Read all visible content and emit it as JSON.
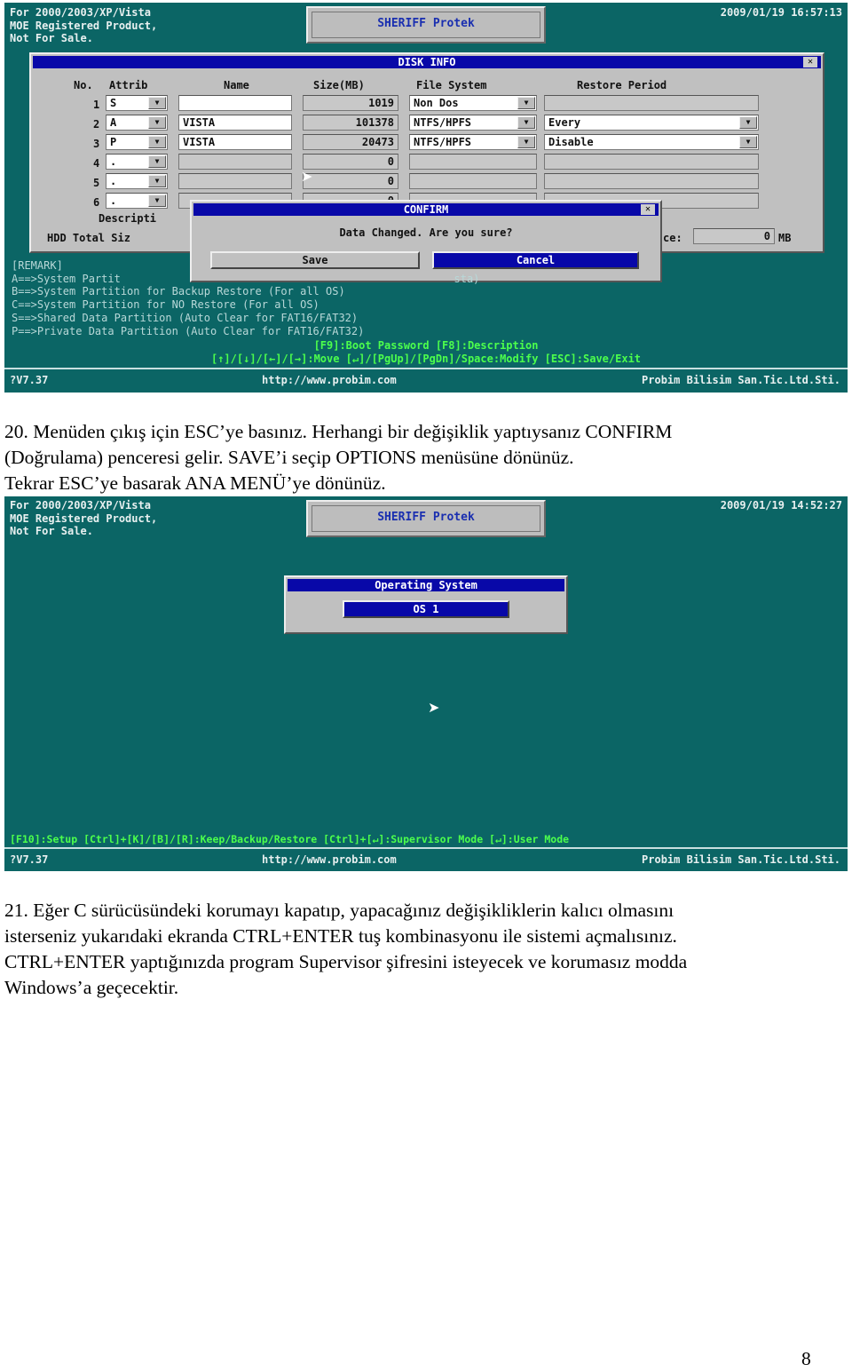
{
  "screen1": {
    "header_lines": [
      "For 2000/2003/XP/Vista",
      "MOE Registered Product,",
      "Not For Sale."
    ],
    "logo": "SHERIFF Protek",
    "datetime": "2009/01/19 16:57:13",
    "disk_info": {
      "title": "DISK INFO",
      "close": "✕",
      "columns": {
        "no": "No.",
        "attrib": "Attrib",
        "name": "Name",
        "size": "Size(MB)",
        "fs": "File System",
        "restore": "Restore Period"
      },
      "rows": [
        {
          "no": "1",
          "attrib": "S",
          "name": "",
          "size": "1019",
          "fs": "Non Dos",
          "restore": ""
        },
        {
          "no": "2",
          "attrib": "A",
          "name": "VISTA",
          "size": "101378",
          "fs": "NTFS/HPFS",
          "restore": "Every"
        },
        {
          "no": "3",
          "attrib": "P",
          "name": "VISTA",
          "size": "20473",
          "fs": "NTFS/HPFS",
          "restore": "Disable"
        },
        {
          "no": "4",
          "attrib": ".",
          "name": "",
          "size": "0",
          "fs": "",
          "restore": ""
        },
        {
          "no": "5",
          "attrib": ".",
          "name": "",
          "size": "0",
          "fs": "",
          "restore": ""
        },
        {
          "no": "6",
          "attrib": ".",
          "name": "",
          "size": "0",
          "fs": "",
          "restore": ""
        }
      ],
      "description_label": "Descripti",
      "hdd_total_label": "HDD Total Siz",
      "free_label": "ce:",
      "free_value": "0",
      "free_unit": "MB"
    },
    "confirm": {
      "title": "CONFIRM",
      "close": "✕",
      "message": "Data Changed. Are you sure?",
      "save": "Save",
      "cancel": "Cancel"
    },
    "remarks": [
      "[REMARK]",
      "A==>System Partit                                                    sta)",
      "B==>System Partition for Backup Restore (For all OS)",
      "C==>System Partition for NO Restore (For all OS)",
      "S==>Shared Data Partition (Auto Clear for FAT16/FAT32)",
      "P==>Private Data Partition (Auto Clear for FAT16/FAT32)"
    ],
    "keys_line1": "[F9]:Boot Password  [F8]:Description",
    "keys_line2": "[↑]/[↓]/[←]/[→]:Move  [↵]/[PgUp]/[PgDn]/Space:Modify  [ESC]:Save/Exit",
    "footer": {
      "version": "?V7.37",
      "url": "http://www.probim.com",
      "company": "Probim Bilisim San.Tic.Ltd.Sti."
    }
  },
  "instruction20": [
    "20. Menüden çıkış için ESC’ye basınız. Herhangi bir değişiklik yaptıysanız CONFIRM",
    "(Doğrulama) penceresi gelir. SAVE’i seçip OPTIONS menüsüne dönünüz.",
    "Tekrar ESC’ye basarak ANA MENÜ’ye dönünüz."
  ],
  "screen2": {
    "header_lines": [
      "For 2000/2003/XP/Vista",
      "MOE Registered Product,",
      "Not For Sale."
    ],
    "logo": "SHERIFF Protek",
    "datetime": "2009/01/19 14:52:27",
    "os_window": {
      "title": "Operating System",
      "option": "OS 1"
    },
    "keys_line": "[F10]:Setup [Ctrl]+[K]/[B]/[R]:Keep/Backup/Restore [Ctrl]+[↵]:Supervisor Mode [↵]:User Mode",
    "footer": {
      "version": "?V7.37",
      "url": "http://www.probim.com",
      "company": "Probim Bilisim San.Tic.Ltd.Sti."
    }
  },
  "instruction21": [
    "21. Eğer C sürücüsündeki korumayı kapatıp, yapacağınız değişikliklerin kalıcı olmasını",
    "isterseniz yukarıdaki ekranda CTRL+ENTER tuş kombinasyonu ile sistemi açmalısınız.",
    "CTRL+ENTER yaptığınızda program Supervisor şifresini isteyecek ve korumasız modda",
    "Windows’a geçecektir."
  ],
  "page_number": "8",
  "colors": {
    "screen_bg": "#0b6565",
    "title_bar": "#0808a8",
    "window": "#c0c0c0",
    "key_hint": "#4cff4c"
  }
}
